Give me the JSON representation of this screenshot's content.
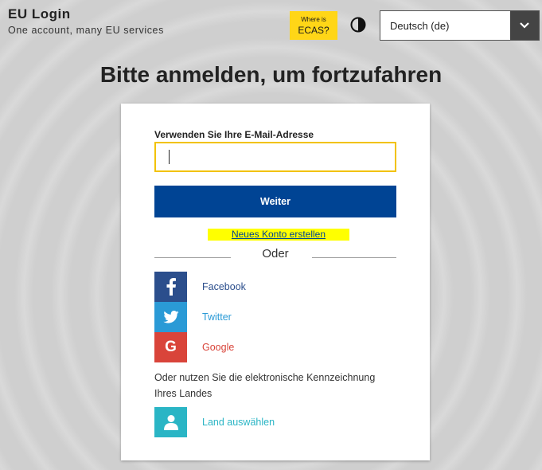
{
  "header": {
    "title": "EU Login",
    "subtitle": "One account, many EU services",
    "ecas_small": "Where is",
    "ecas_big": "ECAS?",
    "contrast_icon": "contrast-icon",
    "language": {
      "selected": "Deutsch (de)",
      "caret_icon": "chevron-down-icon"
    }
  },
  "page_title": "Bitte anmelden, um fortzufahren",
  "form": {
    "email_label": "Verwenden Sie Ihre E-Mail-Adresse",
    "email_value": "",
    "next_label": "Weiter",
    "create_account": "Neues Konto erstellen",
    "or_text": "Oder"
  },
  "social": [
    {
      "name": "Facebook",
      "icon": "facebook-icon",
      "color": "#2b4e8c",
      "text_color": "#2b4e8c"
    },
    {
      "name": "Twitter",
      "icon": "twitter-icon",
      "color": "#2a9ad6",
      "text_color": "#2a9ad6"
    },
    {
      "name": "Google",
      "icon": "google-icon",
      "color": "#d9443a",
      "text_color": "#d9443a"
    }
  ],
  "national_hint": "Oder nutzen Sie die elektronische Kennzeichnung Ihres Landes",
  "country": {
    "label": "Land auswählen",
    "icon": "user-icon",
    "color": "#2ab5c5"
  },
  "colors": {
    "accent": "#004494",
    "highlight": "#ffff00",
    "ecas": "#ffd617"
  }
}
